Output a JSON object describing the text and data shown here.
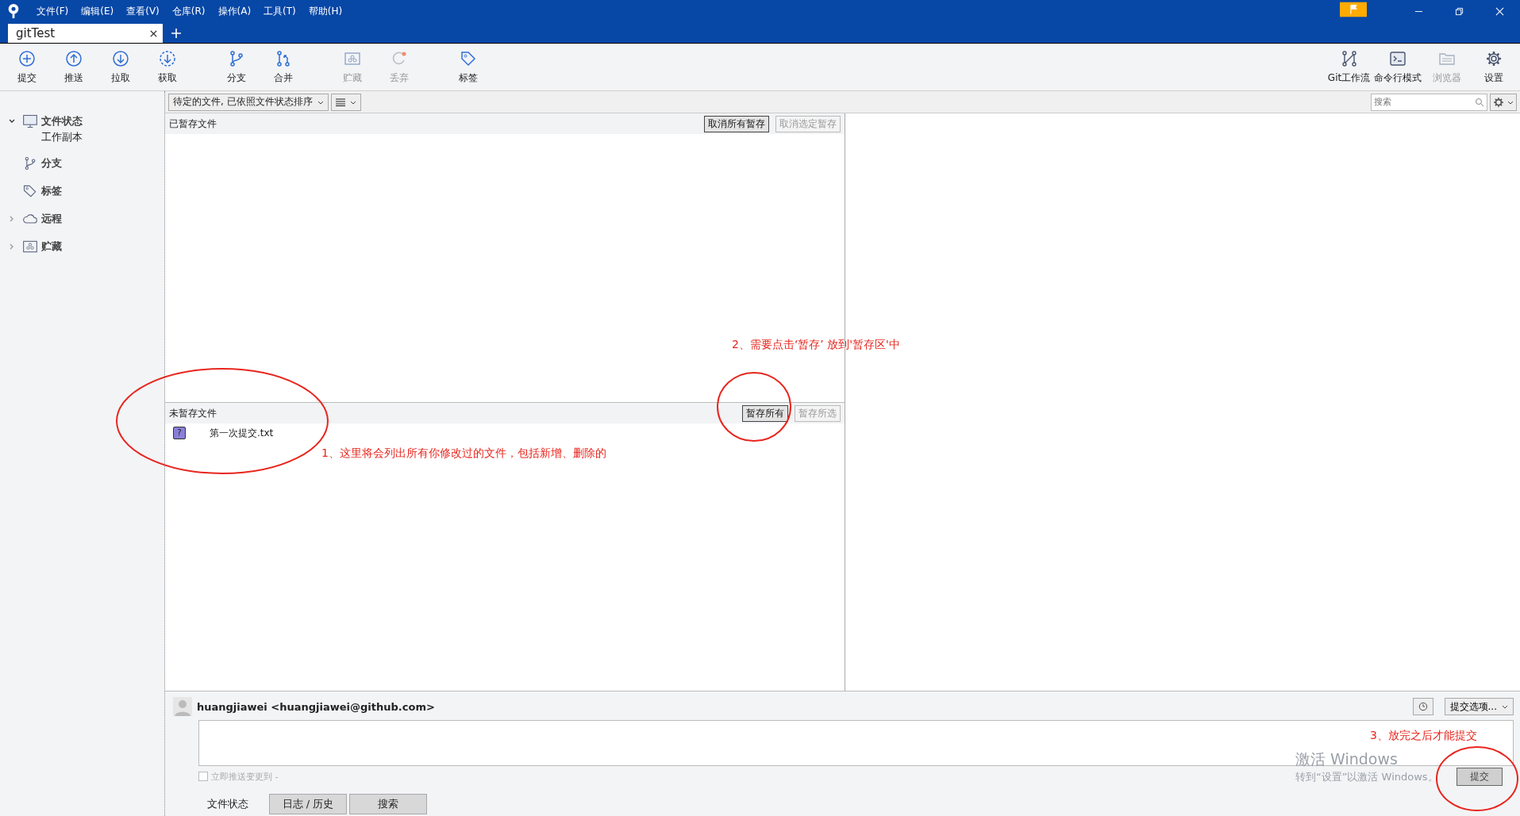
{
  "menu": [
    "文件(F)",
    "编辑(E)",
    "查看(V)",
    "仓库(R)",
    "操作(A)",
    "工具(T)",
    "帮助(H)"
  ],
  "tabs": [
    {
      "label": "gitTest",
      "selected": true
    }
  ],
  "toolbar_left": [
    {
      "label": "提交",
      "disabled": false
    },
    {
      "label": "推送",
      "disabled": false
    },
    {
      "label": "拉取",
      "disabled": false
    },
    {
      "label": "获取",
      "disabled": false
    },
    {
      "label": "分支",
      "disabled": false
    },
    {
      "label": "合并",
      "disabled": false
    },
    {
      "label": "贮藏",
      "disabled": true
    },
    {
      "label": "丢弃",
      "disabled": true
    },
    {
      "label": "标签",
      "disabled": false
    }
  ],
  "toolbar_right": [
    {
      "label": "Git工作流",
      "disabled": false
    },
    {
      "label": "命令行模式",
      "disabled": false
    },
    {
      "label": "浏览器",
      "disabled": true
    },
    {
      "label": "设置",
      "disabled": false
    }
  ],
  "sidebar": {
    "items": [
      {
        "label": "文件状态",
        "expanded": true,
        "children": [
          {
            "label": "工作副本"
          }
        ]
      },
      {
        "label": "分支"
      },
      {
        "label": "标签"
      },
      {
        "label": "远程",
        "expanded": false
      },
      {
        "label": "贮藏",
        "expanded": false
      }
    ]
  },
  "filter": {
    "sort": "待定的文件, 已依照文件状态排序",
    "search_placeholder": "搜索"
  },
  "staged": {
    "title": "已暂存文件",
    "buttons": [
      {
        "label": "取消所有暂存",
        "disabled": false
      },
      {
        "label": "取消选定暂存",
        "disabled": true
      }
    ]
  },
  "unstaged": {
    "title": "未暂存文件",
    "buttons": [
      {
        "label": "暂存所有",
        "disabled": false
      },
      {
        "label": "暂存所选",
        "disabled": true
      }
    ],
    "files": [
      {
        "name": "第一次提交.txt",
        "status": "?"
      }
    ]
  },
  "commit": {
    "author": "huangjiawei <huangjiawei@github.com>",
    "options": "提交选项...",
    "push_label": "立即推送变更到 -",
    "push_checked": false,
    "button": "提交"
  },
  "bottom_tabs": [
    {
      "label": "文件状态",
      "selected": true
    },
    {
      "label": "日志 / 历史",
      "selected": false
    },
    {
      "label": "搜索",
      "selected": false
    }
  ],
  "annotations": [
    {
      "text": "1、这里将会列出所有你修改过的文件，包括新增、删除的"
    },
    {
      "text": "2、需要点击‘暂存’ 放到'暂存区'中"
    },
    {
      "text": "3、放完之后才能提交"
    }
  ],
  "activation": {
    "title": "激活 Windows",
    "subtitle": "转到“设置”以激活 Windows。"
  }
}
